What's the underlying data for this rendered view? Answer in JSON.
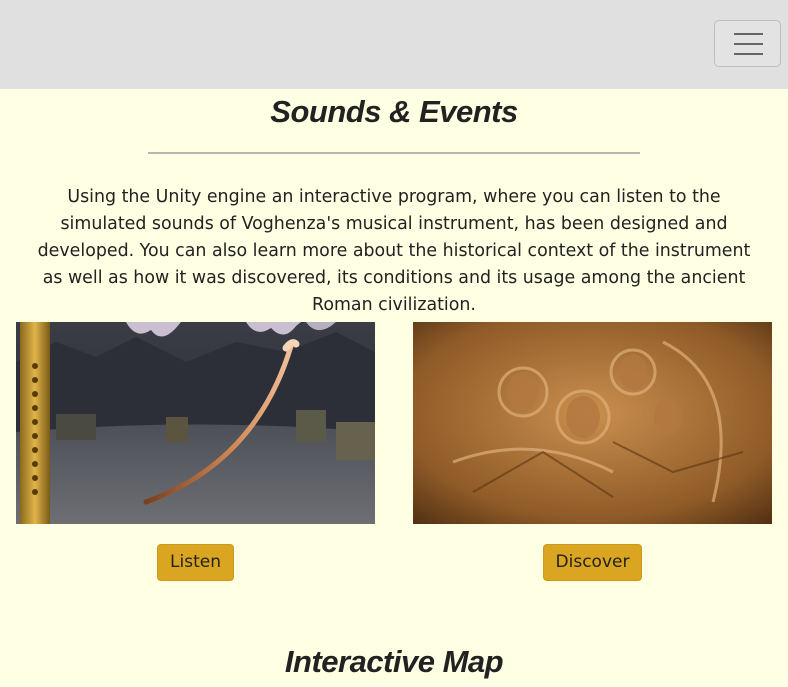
{
  "navbar": {
    "toggle_icon": "hamburger-menu-icon"
  },
  "sounds_section": {
    "title": "Sounds & Events",
    "description": "Using the Unity engine an interactive program, where you can listen to the simulated sounds of Voghenza's musical instrument, has been designed and developed. You can also learn more about the historical context of the instrument as well as how it was discovered, its conditions and its usage among the ancient Roman civilization.",
    "cards": [
      {
        "button_label": "Listen"
      },
      {
        "button_label": "Discover"
      }
    ]
  },
  "map_section": {
    "title": "Interactive Map"
  },
  "colors": {
    "background": "#ffffe3",
    "navbar": "#e0e0e0",
    "button": "#daa520"
  }
}
